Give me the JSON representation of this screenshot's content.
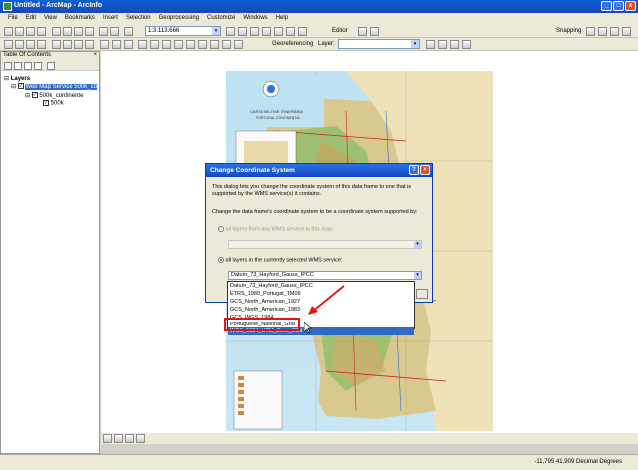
{
  "window": {
    "title": "Untitled - ArcMap - ArcInfo"
  },
  "menu": [
    "File",
    "Edit",
    "View",
    "Bookmarks",
    "Insert",
    "Selection",
    "Geoprocessing",
    "Customize",
    "Windows",
    "Help"
  ],
  "toolbar": {
    "scale": "1:3.113.666",
    "editor_label": "Editor",
    "snapping_label": "Snapping",
    "georeferencing_label": "Georeferencing",
    "layer_label": "Layer:"
  },
  "toc": {
    "title": "Table Of Contents",
    "close": "×",
    "layers_label": "Layers",
    "web_map_service": "Web Map Service 500k_co",
    "continente": "500k_continente",
    "k500": "500k"
  },
  "map": {
    "legend_title": "CARTA MILITAR ITINERÁRIA",
    "legend_subtitle": "PORTUGAL CONTINENTAL"
  },
  "dialog": {
    "title": "Change Coordinate System",
    "intro": "This dialog lets you change the coordinate system of this data frame to one that is supported by the WMS service(s) it contains.",
    "instruction": "Change the data frame's coordinate system to be a coordinate system supported by:",
    "option_all_layers_any": "all layers from any WMS service in this map:",
    "option_selected_service": "all layers in the currently selected WMS service:",
    "selected_value": "Datum_73_Hayford_Gauss_IPCC",
    "options": [
      "Datum_73_Hayford_Gauss_IPCC",
      "ETRS_1989_Portugal_TM06",
      "GCS_North_American_1927",
      "GCS_North_American_1983",
      "GCS_WGS_1984",
      "Portuguese_National_Grid",
      "WGS_1984_UTM_Zone_29N"
    ],
    "help": "?",
    "close": "×"
  },
  "status": {
    "coords": "-11,795  41,909 Decimal Degrees"
  },
  "colors": {
    "annotation_red": "#e01616",
    "selection_blue": "#316ac5"
  }
}
